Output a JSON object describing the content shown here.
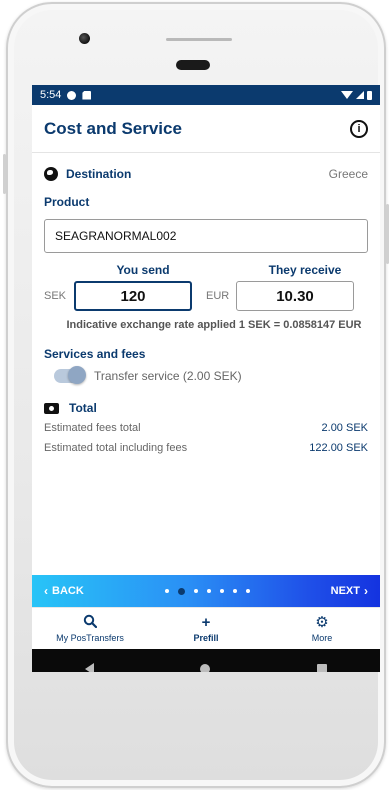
{
  "statusbar": {
    "time": "5:54"
  },
  "appbar": {
    "title": "Cost and Service",
    "info_glyph": "i"
  },
  "destination": {
    "label": "Destination",
    "value": "Greece"
  },
  "product": {
    "label": "Product",
    "value": "SEAGRANORMAL002"
  },
  "send": {
    "label": "You send",
    "currency": "SEK",
    "amount": "120"
  },
  "receive": {
    "label": "They receive",
    "currency": "EUR",
    "amount": "10.30"
  },
  "rate_text": "Indicative exchange rate applied 1 SEK = 0.0858147 EUR",
  "services": {
    "label": "Services and fees",
    "toggle_label": "Transfer service (2.00 SEK)",
    "toggle_on": true
  },
  "total": {
    "label": "Total",
    "lines": [
      {
        "key": "Estimated fees total",
        "value": "2.00 SEK"
      },
      {
        "key": "Estimated total including fees",
        "value": "122.00 SEK"
      }
    ]
  },
  "pager": {
    "back_label": "BACK",
    "next_label": "NEXT",
    "page_count": 7,
    "current_page": 2
  },
  "tabs": [
    {
      "icon": "search-icon",
      "label": "My PosTransfers"
    },
    {
      "icon": "plus-icon",
      "label": "Prefill"
    },
    {
      "icon": "gear-icon",
      "label": "More"
    }
  ],
  "colors": {
    "brand": "#0b3a6e",
    "accent_start": "#28c4f7",
    "accent_end": "#1433e0"
  }
}
